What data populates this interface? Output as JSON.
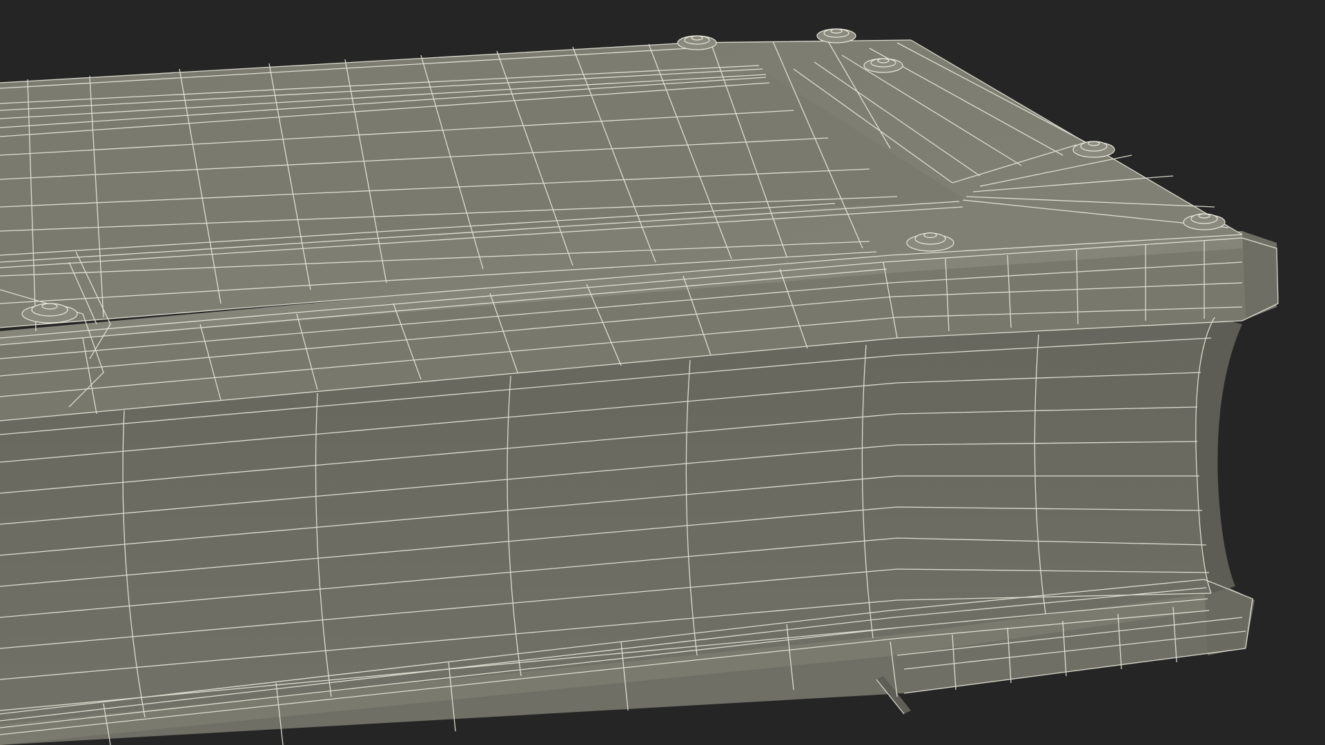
{
  "scene": {
    "subject": "casket-wireframe-model",
    "colors": {
      "background": "#252525",
      "top_surface": "#7c7c71",
      "rim": "#76766b",
      "side_face": "#6b6b62",
      "base": "#737368",
      "wire": "#e9e9dc"
    }
  }
}
